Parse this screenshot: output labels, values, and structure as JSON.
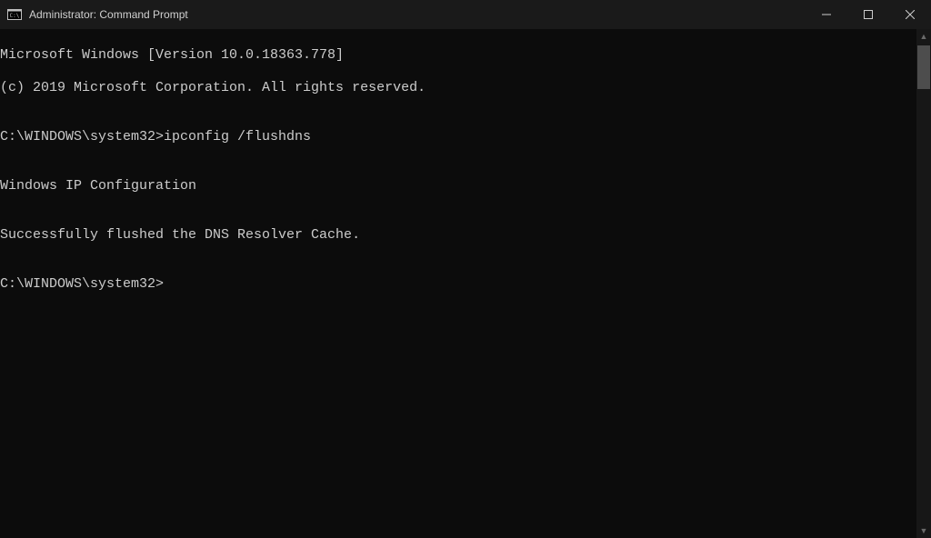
{
  "titlebar": {
    "title": "Administrator: Command Prompt"
  },
  "terminal": {
    "lines": [
      "Microsoft Windows [Version 10.0.18363.778]",
      "(c) 2019 Microsoft Corporation. All rights reserved.",
      "",
      "C:\\WINDOWS\\system32>ipconfig /flushdns",
      "",
      "Windows IP Configuration",
      "",
      "Successfully flushed the DNS Resolver Cache.",
      "",
      "C:\\WINDOWS\\system32>"
    ]
  }
}
